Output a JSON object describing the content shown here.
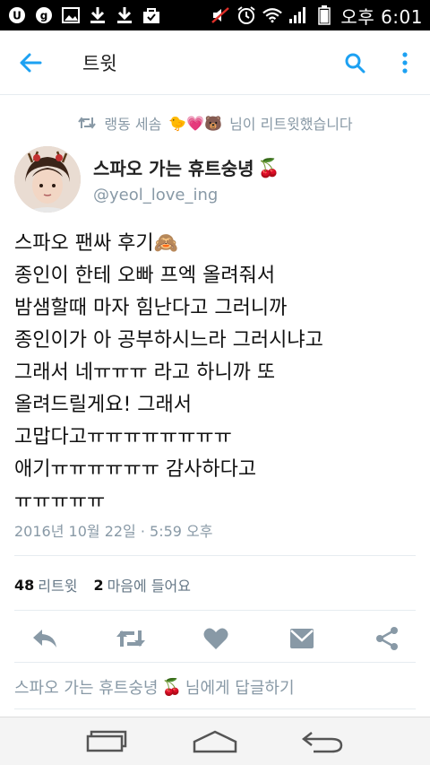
{
  "status_bar": {
    "time": "오후 6:01",
    "icons": [
      "usim-icon",
      "g-icon",
      "image-icon",
      "download-icon",
      "download-icon",
      "bag-icon",
      "mute-icon",
      "alarm-icon",
      "wifi-icon",
      "signal-icon",
      "battery-icon"
    ]
  },
  "app_bar": {
    "title": "트윗",
    "back_icon": "arrow-left-icon",
    "search_icon": "search-icon",
    "more_icon": "more-vert-icon",
    "accent": "#1da1f2"
  },
  "retweet_context": {
    "text_before": "랭동 세솜",
    "emojis": "🐤💗🐻",
    "text_after": "님이 리트윗했습니다"
  },
  "author": {
    "name": "스파오 가는 휴트숭녕",
    "name_emoji": "🍒",
    "handle": "@yeol_love_ing"
  },
  "tweet": {
    "lines": [
      "스파오 팬싸 후기🙈",
      "종인이 한테 오빠 프엑 올려줘서",
      "밤샘할때 마자 힘난다고 그러니까",
      "종인이가 아 공부하시느라 그러시냐고",
      "그래서 네ㅠㅠㅠ 라고 하니까 또",
      "올려드릴게요! 그래서",
      "고맙다고ㅠㅠㅠㅠㅠㅠㅠㅠ",
      "애기ㅠㅠㅠㅠㅠㅠ 감사하다고",
      "ㅠㅠㅠㅠㅠ"
    ],
    "timestamp": "2016년 10월 22일 · 5:59 오후"
  },
  "stats": {
    "retweets_count": "48",
    "retweets_label": "리트윗",
    "likes_count": "2",
    "likes_label": "마음에 들어요"
  },
  "actions": [
    "reply-icon",
    "retweet-icon",
    "heart-icon",
    "message-icon",
    "share-icon"
  ],
  "reply": {
    "name": "스파오 가는 휴트숭녕",
    "emoji": "🍒",
    "suffix": "님에게 답글하기"
  },
  "nav_bar": [
    "recent-apps-icon",
    "home-icon",
    "back-icon"
  ]
}
